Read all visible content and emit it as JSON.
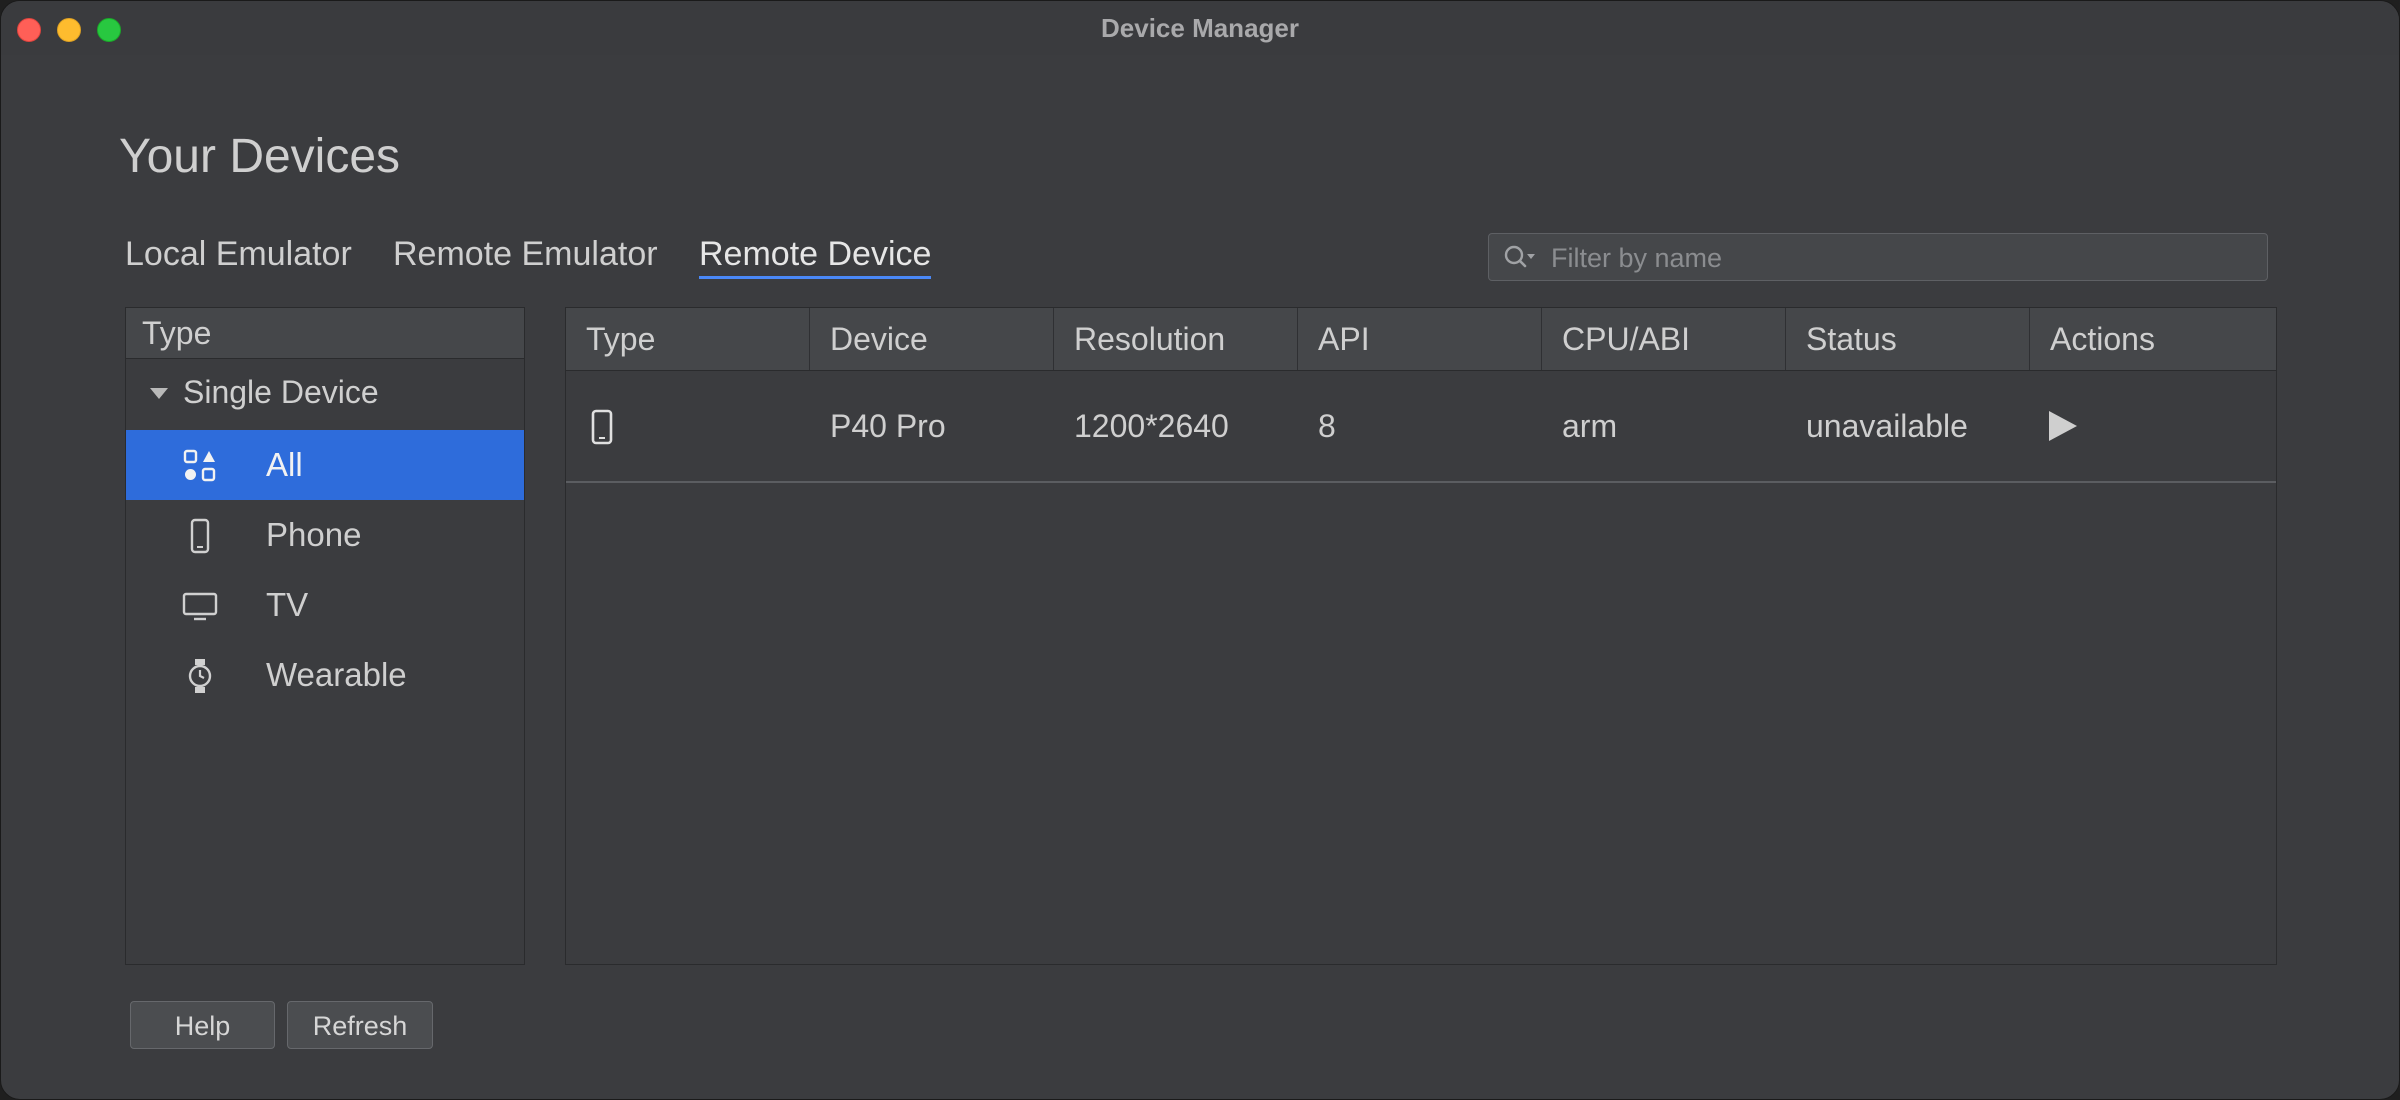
{
  "window": {
    "title": "Device Manager",
    "controls": [
      "close",
      "minimize",
      "maximize"
    ]
  },
  "page": {
    "title": "Your Devices"
  },
  "tabs": [
    {
      "label": "Local Emulator",
      "active": false
    },
    {
      "label": "Remote Emulator",
      "active": false
    },
    {
      "label": "Remote Device",
      "active": true
    }
  ],
  "search": {
    "placeholder": "Filter by name",
    "value": "",
    "icon": "search-icon"
  },
  "sidebar": {
    "header": "Type",
    "group": {
      "label": "Single Device",
      "expanded": true
    },
    "items": [
      {
        "label": "All",
        "icon": "all-types-icon",
        "selected": true
      },
      {
        "label": "Phone",
        "icon": "phone-icon",
        "selected": false
      },
      {
        "label": "TV",
        "icon": "tv-icon",
        "selected": false
      },
      {
        "label": "Wearable",
        "icon": "watch-icon",
        "selected": false
      }
    ]
  },
  "table": {
    "columns": [
      "Type",
      "Device",
      "Resolution",
      "API",
      "CPU/ABI",
      "Status",
      "Actions"
    ],
    "rows": [
      {
        "type_icon": "phone-icon",
        "device": "P40 Pro",
        "resolution": "1200*2640",
        "api": "8",
        "cpu_abi": "arm",
        "status": "unavailable",
        "action_icon": "play-icon"
      }
    ]
  },
  "buttons": {
    "help": "Help",
    "refresh": "Refresh"
  },
  "colors": {
    "accent": "#2e6cdb",
    "tab_underline": "#4a88f7",
    "background": "#3b3c3f"
  }
}
